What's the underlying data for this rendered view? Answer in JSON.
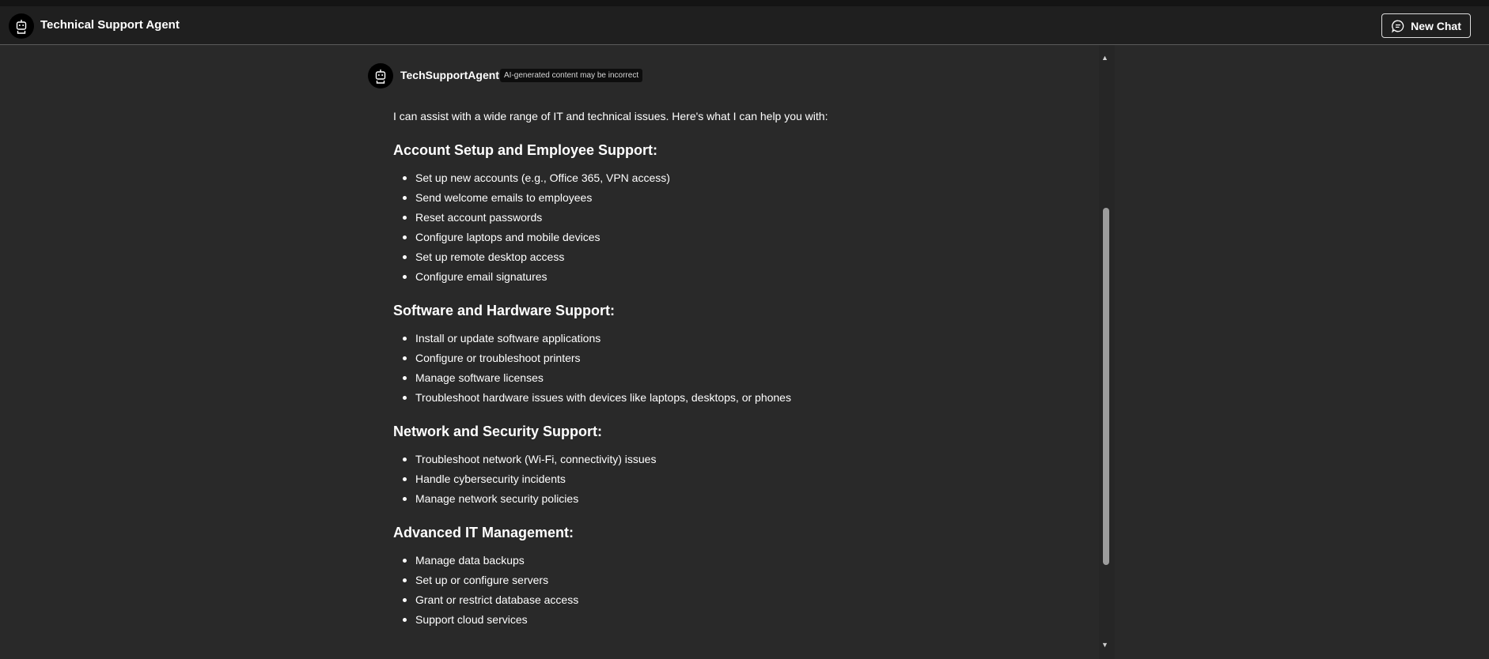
{
  "header": {
    "title": "Technical Support Agent",
    "avatar_icon": "robot-icon",
    "new_chat_label": "New Chat",
    "new_chat_icon": "chat-bubble-icon"
  },
  "message": {
    "sender": "TechSupportAgent",
    "avatar_icon": "robot-icon",
    "badge": "AI-generated content may be incorrect",
    "intro": "I can assist with a wide range of IT and technical issues. Here's what I can help you with:",
    "sections": [
      {
        "heading": "Account Setup and Employee Support:",
        "items": [
          "Set up new accounts (e.g., Office 365, VPN access)",
          "Send welcome emails to employees",
          "Reset account passwords",
          "Configure laptops and mobile devices",
          "Set up remote desktop access",
          "Configure email signatures"
        ]
      },
      {
        "heading": "Software and Hardware Support:",
        "items": [
          "Install or update software applications",
          "Configure or troubleshoot printers",
          "Manage software licenses",
          "Troubleshoot hardware issues with devices like laptops, desktops, or phones"
        ]
      },
      {
        "heading": "Network and Security Support:",
        "items": [
          "Troubleshoot network (Wi-Fi, connectivity) issues",
          "Handle cybersecurity incidents",
          "Manage network security policies"
        ]
      },
      {
        "heading": "Advanced IT Management:",
        "items": [
          "Manage data backups",
          "Set up or configure servers",
          "Grant or restrict database access",
          "Support cloud services"
        ]
      }
    ]
  },
  "scrollbar": {
    "up_icon": "triangle-up-icon",
    "down_icon": "triangle-down-icon"
  }
}
